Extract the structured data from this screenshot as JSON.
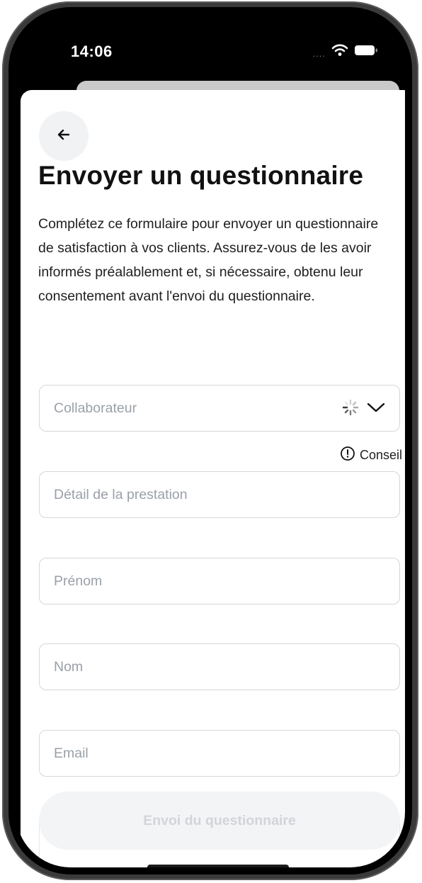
{
  "status_bar": {
    "time": "14:06",
    "signal": "....",
    "icons": [
      "wifi-icon",
      "battery-icon"
    ]
  },
  "header": {
    "back_icon": "arrow-left-icon",
    "title": "Envoyer un questionnaire",
    "description": "Complétez ce formulaire pour envoyer un questionnaire de satisfaction à vos clients. Assurez-vous de les avoir informés préalablement et, si nécessaire, obtenu leur consentement avant l'envoi du questionnaire."
  },
  "form": {
    "collaborator": {
      "placeholder": "Collaborateur",
      "icons": [
        "loading-spinner-icon",
        "chevron-down-icon"
      ]
    },
    "hint": {
      "icon": "info-icon",
      "label": "Conseil"
    },
    "service_detail": {
      "placeholder": "Détail de la prestation"
    },
    "first_name": {
      "placeholder": "Prénom"
    },
    "last_name": {
      "placeholder": "Nom"
    },
    "email": {
      "placeholder": "Email"
    },
    "submit_label": "Envoi du questionnaire"
  },
  "colors": {
    "text": "#111111",
    "placeholder": "#9aa0a8",
    "border": "#d4d6da",
    "button_disabled_bg": "#f3f4f6",
    "button_disabled_text": "#d2d4d8"
  }
}
